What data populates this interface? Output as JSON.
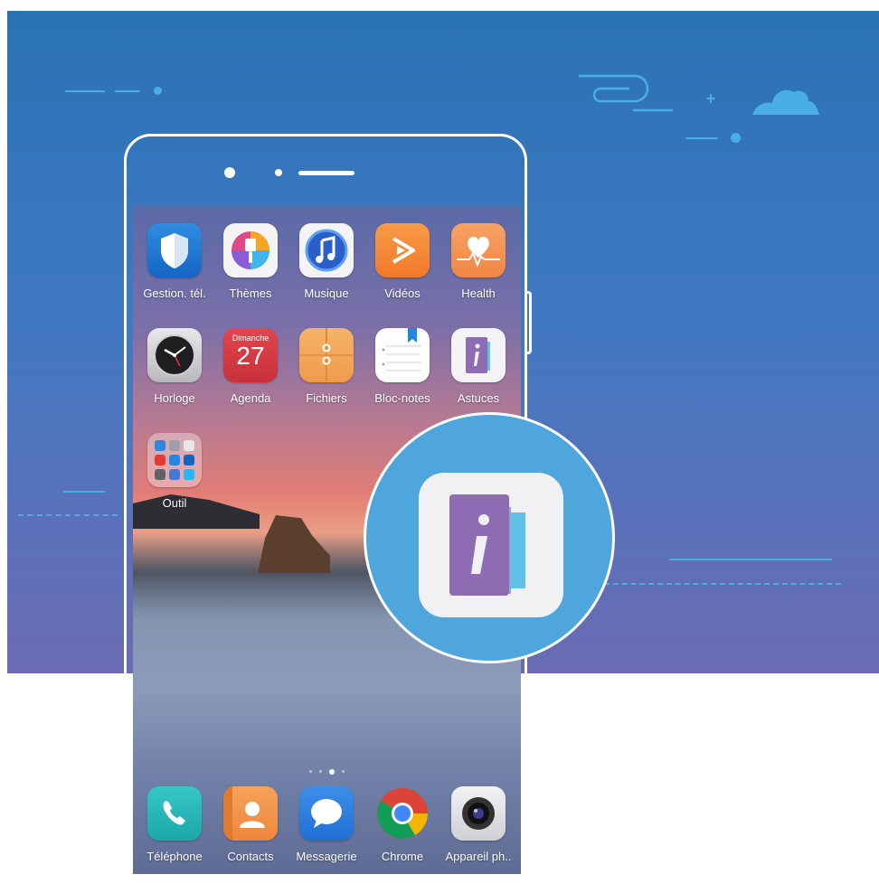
{
  "apps_row1": [
    {
      "label": "Gestion. tél.",
      "icon": "shield-icon"
    },
    {
      "label": "Thèmes",
      "icon": "themes-brush-icon"
    },
    {
      "label": "Musique",
      "icon": "music-note-icon"
    },
    {
      "label": "Vidéos",
      "icon": "video-play-icon"
    },
    {
      "label": "Health",
      "icon": "heart-pulse-icon"
    }
  ],
  "apps_row2": [
    {
      "label": "Horloge",
      "icon": "clock-icon"
    },
    {
      "label": "Agenda",
      "icon": "calendar-icon",
      "day": "Dimanche",
      "date": "27"
    },
    {
      "label": "Fichiers",
      "icon": "folder-icon"
    },
    {
      "label": "Bloc-notes",
      "icon": "notepad-icon"
    },
    {
      "label": "Astuces",
      "icon": "tips-book-icon"
    }
  ],
  "folder": {
    "label": "Outil",
    "icon": "tools-folder-icon"
  },
  "dock": [
    {
      "label": "Téléphone",
      "icon": "phone-icon"
    },
    {
      "label": "Contacts",
      "icon": "contacts-icon"
    },
    {
      "label": "Messagerie",
      "icon": "message-bubble-icon"
    },
    {
      "label": "Chrome",
      "icon": "chrome-icon"
    },
    {
      "label": "Appareil ph..",
      "icon": "camera-icon"
    }
  ],
  "pager": {
    "pages": 4,
    "active_index": 2
  },
  "magnified_icon": {
    "name": "tips-book-icon",
    "letter": "i"
  },
  "colors": {
    "banner_top": "#2a72b4",
    "banner_bottom": "#6a6bb3",
    "accent": "#49aee6",
    "tips_purple": "#8e6cb4"
  }
}
